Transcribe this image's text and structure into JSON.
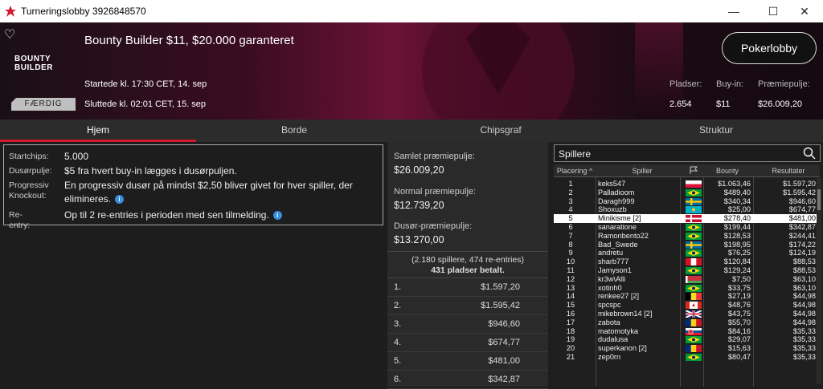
{
  "window": {
    "title": "Turneringslobby 3926848570"
  },
  "header": {
    "logo_line1": "BOUNTY",
    "logo_line2": "BUILDER",
    "title": "Bounty Builder $11, $20.000 garanteret",
    "started": "Startede kl. 17:30 CET, 14. sep",
    "ended": "Sluttede kl. 02:01 CET, 15. sep",
    "status_badge": "FÆRDIG",
    "lobby_button": "Pokerlobby",
    "stats_labels": {
      "seats": "Pladser:",
      "buyin": "Buy-in:",
      "prizepool": "Præmiepulje:"
    },
    "stats_values": {
      "seats": "2.654",
      "buyin": "$11",
      "prizepool": "$26.009,20"
    }
  },
  "tabs": [
    "Hjem",
    "Borde",
    "Chipsgraf",
    "Struktur"
  ],
  "info": {
    "startchips_label": "Startchips:",
    "startchips": "5.000",
    "dusor_label": "Dusørpulje:",
    "dusor": "$5 fra hvert buy-in lægges i dusørpuljen.",
    "pko_label1": "Progressiv",
    "pko_label2": "Knockout:",
    "pko1": "En progressiv dusør på mindst $2,50 bliver givet for hver spiller, der",
    "pko2": "elimineres.",
    "reentry_label": "Re-entry:",
    "reentry": "Op til 2 re-entries i perioden med sen tilmelding."
  },
  "prize": {
    "total_label": "Samlet præmiepulje:",
    "total": "$26.009,20",
    "normal_label": "Normal præmiepulje:",
    "normal": "$12.739,20",
    "bounty_label": "Dusør-præmiepulje:",
    "bounty": "$13.270,00",
    "players_note": "(2.180 spillere, 474 re-entries)",
    "paid_note": "431 pladser betalt.",
    "payouts": [
      {
        "place": "1.",
        "amount": "$1.597,20"
      },
      {
        "place": "2.",
        "amount": "$1.595,42"
      },
      {
        "place": "3.",
        "amount": "$946,60"
      },
      {
        "place": "4.",
        "amount": "$674,77"
      },
      {
        "place": "5.",
        "amount": "$481,00"
      },
      {
        "place": "6.",
        "amount": "$342,87"
      }
    ]
  },
  "players": {
    "search_placeholder": "Spillere",
    "columns": {
      "place": "Placering",
      "player": "Spiller",
      "bounty": "Bounty",
      "result": "Resultater"
    },
    "rows": [
      {
        "place": "1",
        "name": "keks547",
        "flag": "pl",
        "bounty": "$1.063,46",
        "result": "$1.597,20"
      },
      {
        "place": "2",
        "name": "Palladioom",
        "flag": "br",
        "bounty": "$489,40",
        "result": "$1.595,42"
      },
      {
        "place": "3",
        "name": "Daragh999",
        "flag": "se",
        "bounty": "$340,34",
        "result": "$946,60"
      },
      {
        "place": "4",
        "name": "Shoxuzb",
        "flag": "kz",
        "bounty": "$25,00",
        "result": "$674,77"
      },
      {
        "place": "5",
        "name": "Minikisme [2]",
        "flag": "dk",
        "bounty": "$278,40",
        "result": "$481,00"
      },
      {
        "place": "6",
        "name": "sanaratione",
        "flag": "br",
        "bounty": "$199,44",
        "result": "$342,87"
      },
      {
        "place": "7",
        "name": "Ramonbento22",
        "flag": "br",
        "bounty": "$128,53",
        "result": "$244,41"
      },
      {
        "place": "8",
        "name": "Bad_Swede",
        "flag": "se",
        "bounty": "$198,95",
        "result": "$174,22"
      },
      {
        "place": "9",
        "name": "andretu",
        "flag": "br",
        "bounty": "$76,25",
        "result": "$124,19"
      },
      {
        "place": "10",
        "name": "sharb777",
        "flag": "pe",
        "bounty": "$120,84",
        "result": "$88,53"
      },
      {
        "place": "11",
        "name": "Jamyson1",
        "flag": "br",
        "bounty": "$129,24",
        "result": "$88,53"
      },
      {
        "place": "12",
        "name": "kr3w\\Alli",
        "flag": "by",
        "bounty": "$7,50",
        "result": "$63,10"
      },
      {
        "place": "13",
        "name": "xotinh0",
        "flag": "br",
        "bounty": "$33,75",
        "result": "$63,10"
      },
      {
        "place": "14",
        "name": "renkee27 [2]",
        "flag": "be",
        "bounty": "$27,19",
        "result": "$44,98"
      },
      {
        "place": "15",
        "name": "spcspc",
        "flag": "ca",
        "bounty": "$48,76",
        "result": "$44,98"
      },
      {
        "place": "16",
        "name": "mikebrown14 [2]",
        "flag": "gb",
        "bounty": "$43,75",
        "result": "$44,98"
      },
      {
        "place": "17",
        "name": "zabota",
        "flag": "ro",
        "bounty": "$55,70",
        "result": "$44,98"
      },
      {
        "place": "18",
        "name": "matomotyka",
        "flag": "sk",
        "bounty": "$84,16",
        "result": "$35,33"
      },
      {
        "place": "19",
        "name": "dudalusa",
        "flag": "br",
        "bounty": "$29,07",
        "result": "$35,33"
      },
      {
        "place": "20",
        "name": "superkanon [2]",
        "flag": "ro",
        "bounty": "$15,63",
        "result": "$35,33"
      },
      {
        "place": "21",
        "name": "zep0rn",
        "flag": "br",
        "bounty": "$80,47",
        "result": "$35,33"
      }
    ]
  },
  "colors": {
    "accent": "#d01931",
    "info_icon": "#3a8dde"
  }
}
